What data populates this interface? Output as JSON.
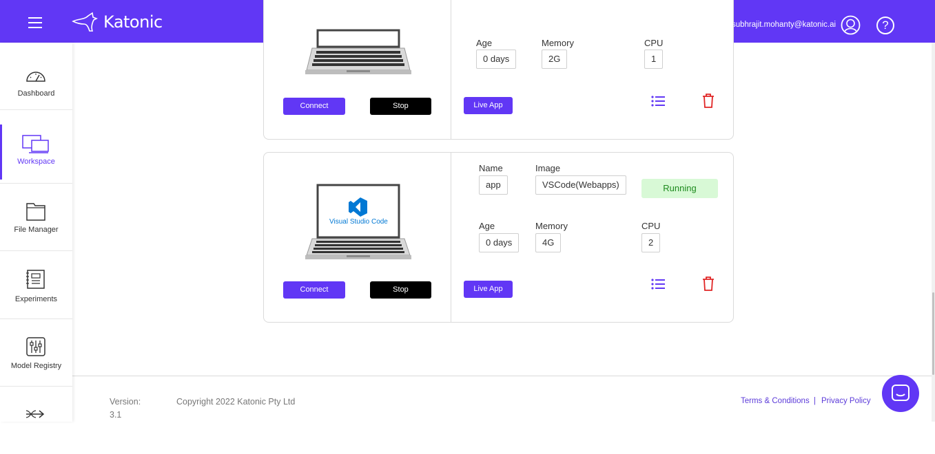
{
  "header": {
    "brand": "Katonic",
    "user_email": "subhrajit.mohanty@katonic.ai",
    "help_glyph": "?"
  },
  "sidebar": {
    "items": [
      {
        "label": "Dashboard",
        "icon": "dashboard-gauge-icon"
      },
      {
        "label": "Workspace",
        "icon": "workspace-monitors-icon",
        "active": true
      },
      {
        "label": "File Manager",
        "icon": "folder-icon"
      },
      {
        "label": "Experiments",
        "icon": "experiments-notebook-icon"
      },
      {
        "label": "Model Registry",
        "icon": "sliders-icon"
      },
      {
        "label": "",
        "icon": "pipeline-arrows-icon"
      }
    ]
  },
  "workspaces": [
    {
      "fields": {
        "age_label": "Age",
        "age": "0 days",
        "memory_label": "Memory",
        "memory": "2G",
        "cpu_label": "CPU",
        "cpu": "1"
      },
      "buttons": {
        "connect": "Connect",
        "stop": "Stop",
        "live_app": "Live App"
      }
    },
    {
      "screen_text": "Visual Studio Code",
      "fields": {
        "name_label": "Name",
        "name": "app",
        "image_label": "Image",
        "image": "VSCode(Webapps)",
        "status": "Running",
        "age_label": "Age",
        "age": "0 days",
        "memory_label": "Memory",
        "memory": "4G",
        "cpu_label": "CPU",
        "cpu": "2"
      },
      "buttons": {
        "connect": "Connect",
        "stop": "Stop",
        "live_app": "Live App"
      }
    }
  ],
  "footer": {
    "version_label": "Version:",
    "version_value": "3.1",
    "copyright": "Copyright 2022 Katonic Pty Ltd",
    "terms": "Terms & Conditions",
    "separator": "|",
    "privacy": "Privacy Policy"
  },
  "colors": {
    "brand": "#6137f5",
    "status_running_bg": "#d8f9d6",
    "status_running_text": "#1d8a1d",
    "delete": "#e02424"
  }
}
